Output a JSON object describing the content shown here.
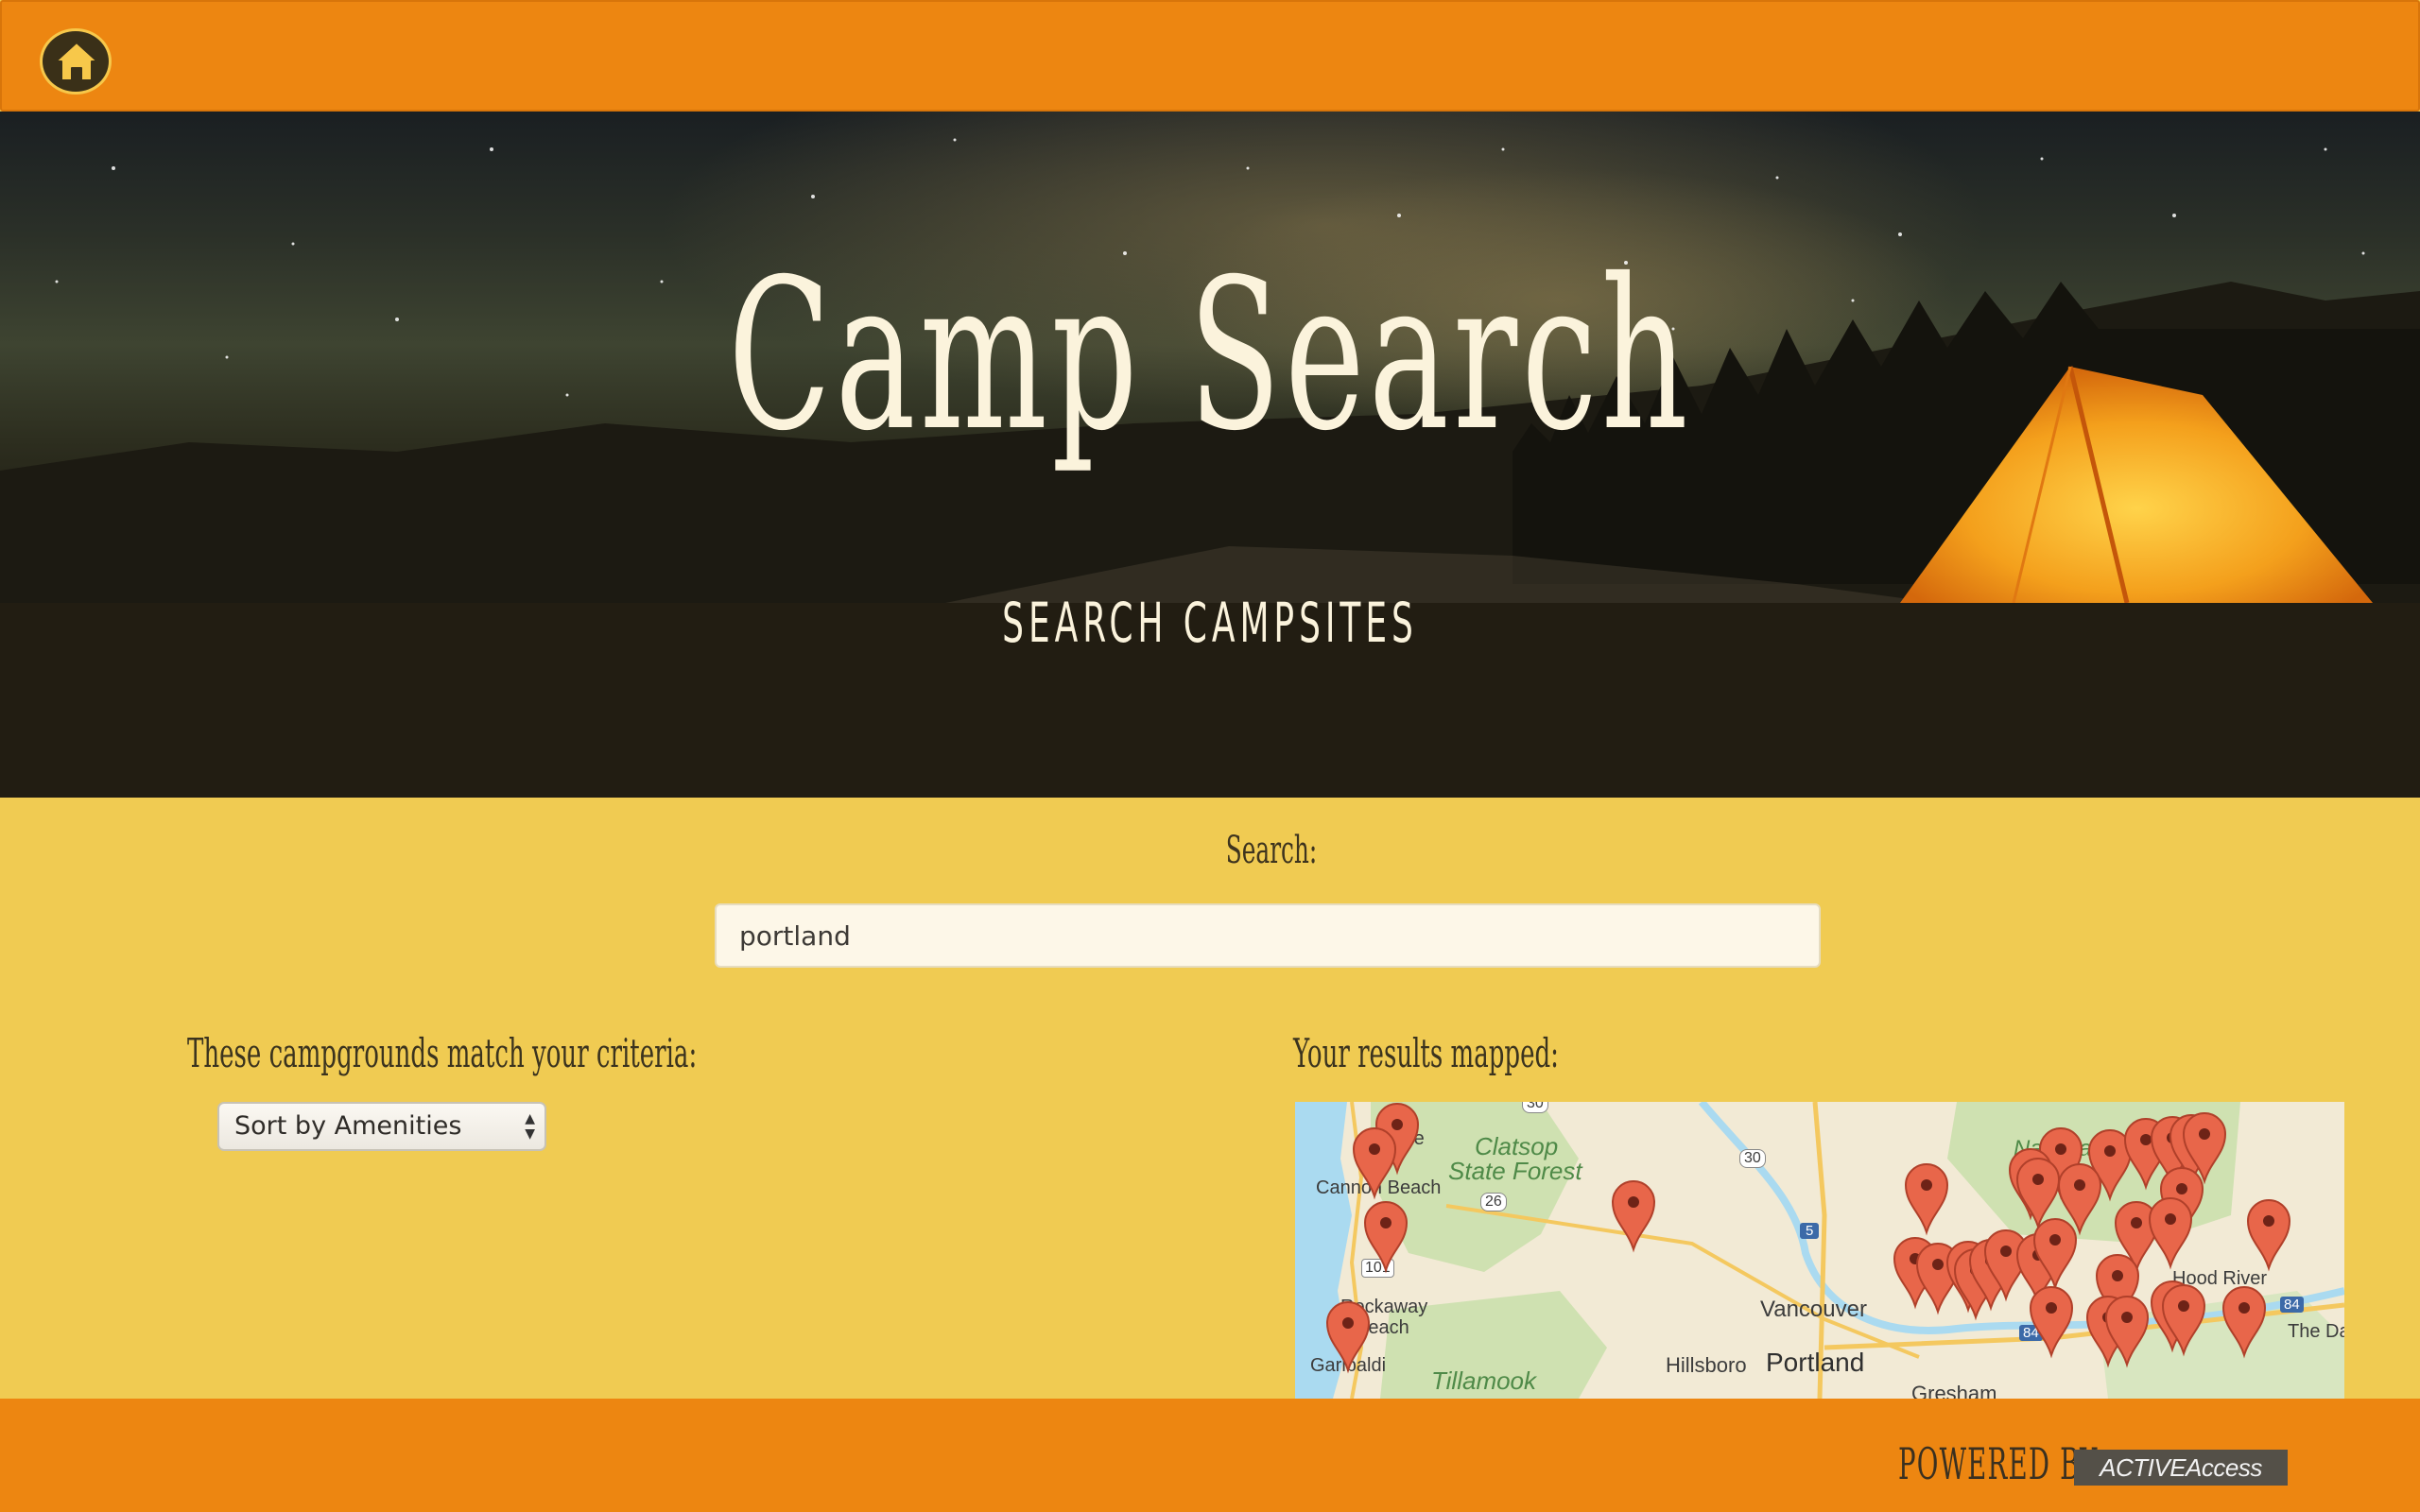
{
  "topbar": {
    "home_label": "home"
  },
  "hero": {
    "title": "Camp Search",
    "subtitle": "SEARCH CAMPSITES"
  },
  "search": {
    "label": "Search:",
    "value": "portland"
  },
  "results": {
    "heading": "These campgrounds match your criteria:",
    "sort_selected": "Sort by Amenities"
  },
  "map": {
    "heading": "Your results mapped:",
    "labels": {
      "clatsop": "Clatsop",
      "state_forest": "State Forest",
      "cannon_beach": "Cannon Beach",
      "rockaway": "Rockaway",
      "beach": "Beach",
      "garibaldi": "Garibaldi",
      "tillamook": "Tillamook",
      "hillsboro": "Hillsboro",
      "portland": "Portland",
      "vancouver": "Vancouver",
      "gresham": "Gresham",
      "hood_river": "Hood River",
      "the_dalles": "The Da",
      "national_forest": "National Forest",
      "ide": "ide",
      "r26": "26",
      "r30": "30",
      "r5": "5",
      "r84a": "84",
      "r84b": "84",
      "r101": "101"
    }
  },
  "footer": {
    "powered_by": "POWERED BY",
    "brand": "ACTIVEAccess"
  },
  "colors": {
    "topbar": "#ed8611",
    "background": "#f0cb52",
    "pin": "#e8664a"
  }
}
